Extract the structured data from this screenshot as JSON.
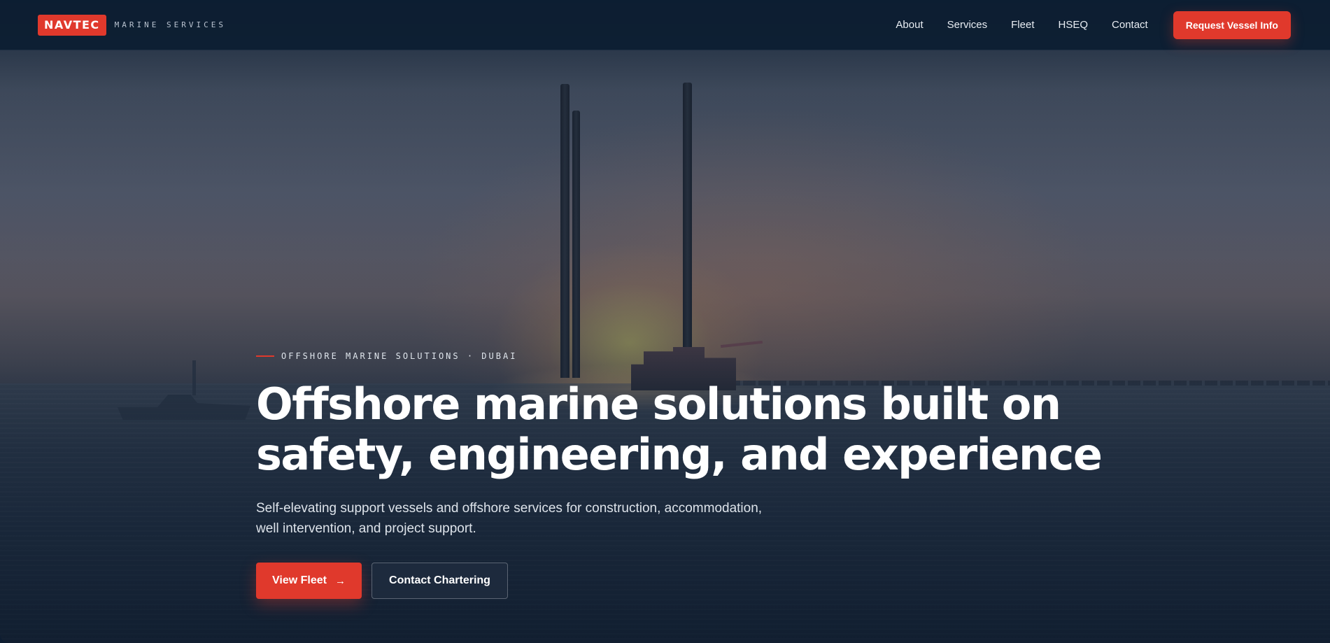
{
  "brand": {
    "logo": "NAVTEC",
    "tagline": "MARINE SERVICES",
    "accent_color": "#e0392c"
  },
  "nav": {
    "links": [
      "About",
      "Services",
      "Fleet",
      "HSEQ",
      "Contact"
    ],
    "cta_label": "Request Vessel Info"
  },
  "hero": {
    "eyebrow": "OFFSHORE MARINE SOLUTIONS · DUBAI",
    "headline_line1": "Offshore marine solutions built on",
    "headline_line2": "safety, engineering, and experience",
    "subtext_line1": "Self-elevating support vessels and offshore services for construction, accommodation,",
    "subtext_line2": "well intervention, and project support.",
    "primary_cta": "View Fleet",
    "primary_cta_icon": "arrow-right-icon",
    "secondary_cta": "Contact Chartering"
  }
}
